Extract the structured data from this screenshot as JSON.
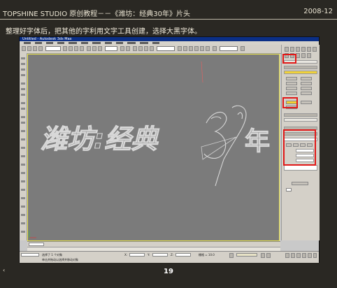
{
  "header": {
    "title": "TOPSHINE STUDIO 原创教程－－《潍坊：经典30年》片头",
    "date": "2008-12"
  },
  "instruction": "整理好字体后，把其他的字利用文字工具创建，选择大黑字体。",
  "page_number": "19",
  "app": {
    "title_bar": "Untitled - Autodesk 3ds Max",
    "viewport": {
      "text_left": "潍坊:经典",
      "text_right": "年",
      "label": "Perspective"
    },
    "status": {
      "selection": "选择了 1 个对象",
      "hint": "单击并拖动以选择并移动对象",
      "x_label": "X:",
      "y_label": "Y:",
      "z_label": "Z:",
      "x_value": "27.13",
      "y_value": "0.0",
      "z_value": "0.0",
      "grid": "栅格 = 10.0",
      "frame": "0 / 100"
    },
    "right_panel": {
      "section_labels": [
        "名称和颜色",
        "对象类型",
        "参数"
      ],
      "font": "大黑",
      "size_value": "100.0",
      "text_value": "经典"
    }
  }
}
